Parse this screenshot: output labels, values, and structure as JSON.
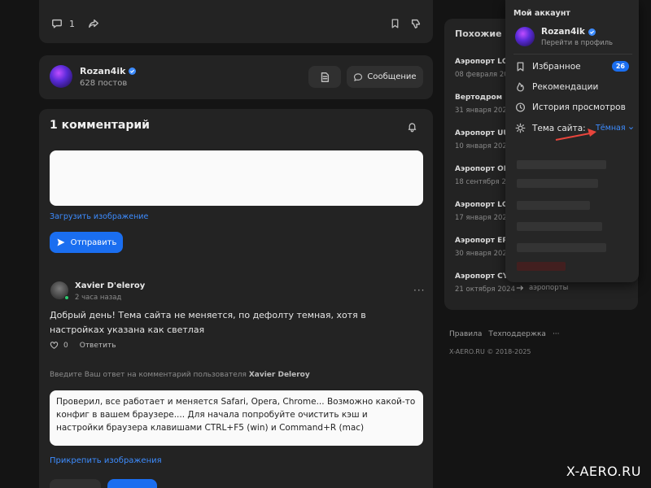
{
  "top_card": {
    "comment_count": "1"
  },
  "author": {
    "name": "Rozan4ik",
    "posts": "628 постов",
    "message_button": "Сообщение"
  },
  "comments": {
    "title": "1 комментарий",
    "upload_image": "Загрузить изображение",
    "send_button": "Отправить",
    "items": [
      {
        "author": "Xavier D'eleroy",
        "time": "2 часа назад",
        "text": "Добрый день! Тема сайта не меняется, по дефолту темная, хотя в настройках указана как светлая",
        "likes": "0",
        "reply": "Ответить"
      }
    ],
    "reply_prompt": "Введите Ваш ответ на комментарий пользователя",
    "reply_prompt_user": "Xavier Deleroy",
    "reply_text": "Проверил, все работает и меняется Safari, Opera, Chrome... Возможно какой-то конфиг в вашем браузере.... Для начала попробуйте очистить кэш и настройки браузера клавишами CTRL+F5 (win) и Command+R (mac)",
    "attach_images": "Прикрепить изображения"
  },
  "similar": {
    "title": "Похожие по",
    "items": [
      {
        "name": "Аэропорт LQS",
        "date": "08 февраля 20"
      },
      {
        "name": "Вертодром EG",
        "date": "31 января 2025"
      },
      {
        "name": "Аэропорт UUE",
        "date": "10 января 2025"
      },
      {
        "name": "Аэропорт OEJ",
        "date": "18 сентября 20"
      },
      {
        "name": "Аэропорт LGZ",
        "date": "17 января 2025"
      },
      {
        "name": "Аэропорт EPK",
        "date": "30 января 2025"
      },
      {
        "name": "Аэропорт CYQ",
        "date": "21 октября 2024"
      }
    ],
    "last_tag": "аэропорты"
  },
  "footer": {
    "links": [
      "Правила",
      "Техподдержка",
      "···"
    ],
    "copyright": "X-AERO.RU © 2018-2025"
  },
  "account_menu": {
    "heading": "Мой аккаунт",
    "username": "Rozan4ik",
    "profile_link": "Перейти в профиль",
    "items": [
      {
        "label": "Избранное",
        "icon": "bookmark-icon",
        "badge": "26"
      },
      {
        "label": "Рекомендации",
        "icon": "flame-icon"
      },
      {
        "label": "История просмотров",
        "icon": "clock-icon"
      }
    ],
    "theme_label": "Тема сайта:",
    "theme_value": "Тёмная"
  },
  "watermark": "X-AERO.RU",
  "colors": {
    "accent": "#1a6ef0",
    "link": "#3d8cff",
    "arrow": "#e8453c",
    "background": "#141414",
    "card": "#232323"
  }
}
